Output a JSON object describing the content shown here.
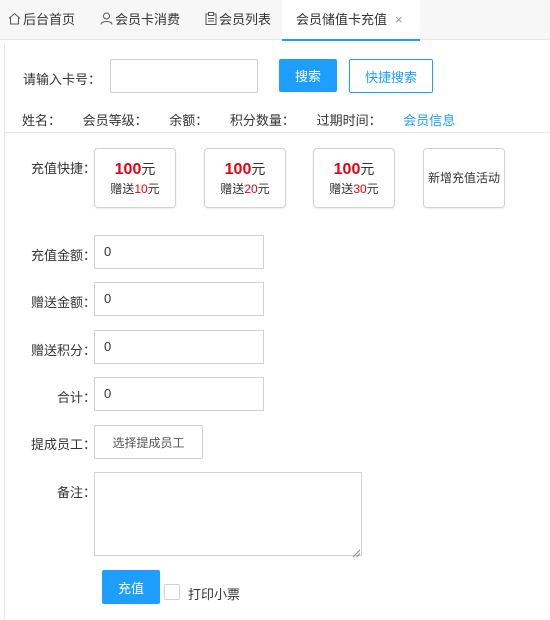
{
  "tabs": [
    {
      "label": "后台首页",
      "icon": "home-icon"
    },
    {
      "label": "会员卡消费",
      "icon": "user-icon"
    },
    {
      "label": "会员列表",
      "icon": "clipboard-icon"
    },
    {
      "label": "会员储值卡充值",
      "icon": "",
      "active": true,
      "close": "×"
    }
  ],
  "search": {
    "label": "请输入卡号：",
    "value": "",
    "search_button": "搜索",
    "quick_search_button": "快捷搜索"
  },
  "member_info": {
    "name_label": "姓名：",
    "level_label": "会员等级：",
    "balance_label": "余额：",
    "points_label": "积分数量：",
    "expire_label": "过期时间：",
    "info_link": "会员信息"
  },
  "quick": {
    "label": "充值快捷：",
    "cards": [
      {
        "amount": "100",
        "unit": "元",
        "gift_prefix": "赠送",
        "gift": "10",
        "gift_unit": "元"
      },
      {
        "amount": "100",
        "unit": "元",
        "gift_prefix": "赠送",
        "gift": "20",
        "gift_unit": "元"
      },
      {
        "amount": "100",
        "unit": "元",
        "gift_prefix": "赠送",
        "gift": "30",
        "gift_unit": "元"
      }
    ],
    "new_activity": "新增充值活动"
  },
  "form": {
    "recharge_label": "充值金额：",
    "recharge_value": "0",
    "gift_label": "赠送金额：",
    "gift_value": "0",
    "points_label": "赠送积分：",
    "points_value": "0",
    "total_label": "合计：",
    "total_value": "0",
    "staff_label": "提成员工：",
    "staff_button": "选择提成员工",
    "remark_label": "备注：",
    "remark_value": ""
  },
  "actions": {
    "submit": "充值",
    "print_label": "打印小票"
  },
  "colors": {
    "accent": "#1e9fff",
    "highlight": "#e60012"
  }
}
